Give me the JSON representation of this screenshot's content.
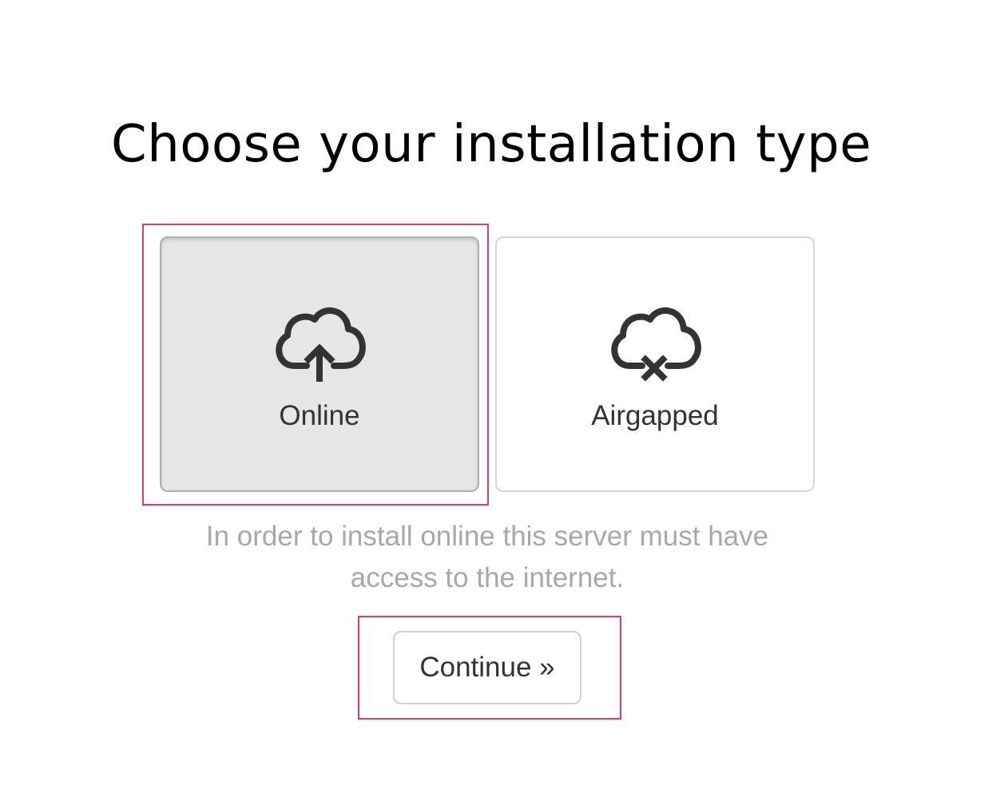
{
  "page": {
    "title": "Choose your installation type"
  },
  "options": [
    {
      "label": "Online",
      "icon": "cloud-upload-icon",
      "selected": true
    },
    {
      "label": "Airgapped",
      "icon": "cloud-offline-icon",
      "selected": false
    }
  ],
  "help": {
    "text": "In order to install online this server must have access to the internet."
  },
  "actions": {
    "continue_label": "Continue »"
  },
  "colors": {
    "highlight": "#e8357a",
    "selected_card_bg": "#e6e6e6",
    "help_text": "#a8a8a8"
  }
}
